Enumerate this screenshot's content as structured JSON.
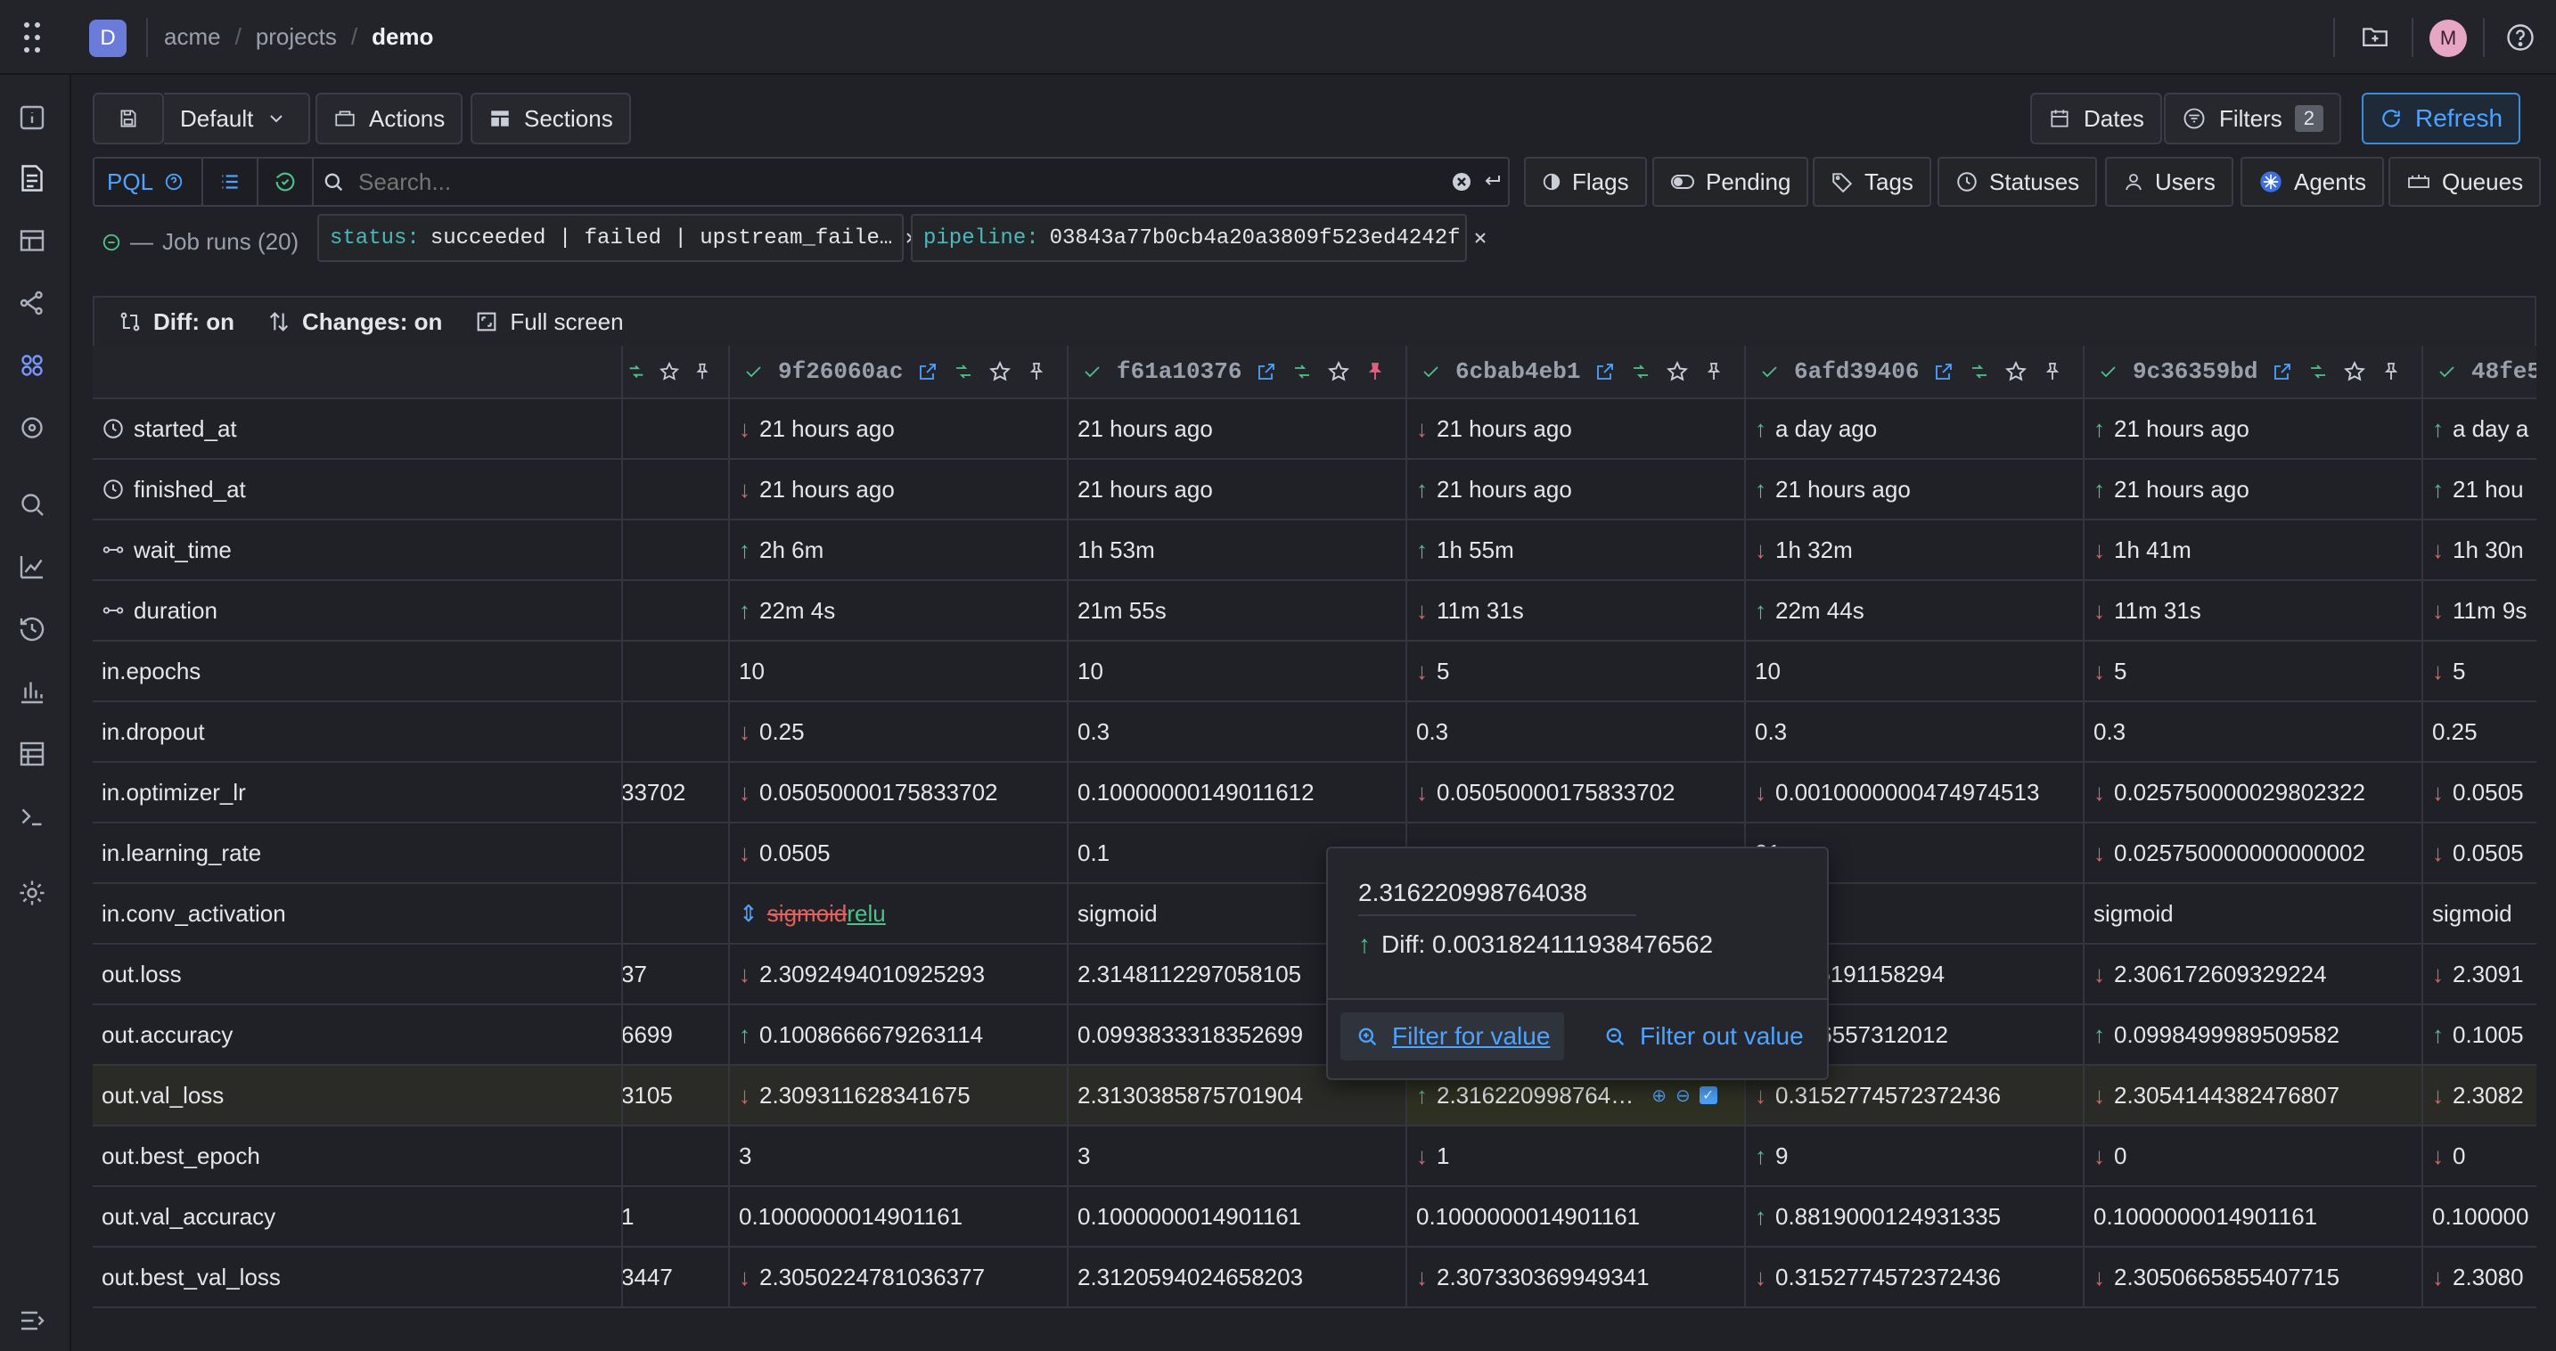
{
  "header": {
    "workspace_letter": "D",
    "breadcrumb": [
      "acme",
      "projects",
      "demo"
    ],
    "avatar": "M"
  },
  "toolbar": {
    "preset": "Default",
    "actions": "Actions",
    "sections": "Sections",
    "dates": "Dates",
    "filters": "Filters",
    "filters_count": "2",
    "refresh": "Refresh"
  },
  "query": {
    "mode": "PQL",
    "search_placeholder": "Search...",
    "chips": [
      "Flags",
      "Pending",
      "Tags",
      "Statuses",
      "Users",
      "Agents",
      "Queues"
    ]
  },
  "filters_bar": {
    "title": "Job runs (20)",
    "status_key": "status:",
    "status_value": "succeeded | failed | upstream_faile…",
    "pipeline_key": "pipeline:",
    "pipeline_value": "03843a77b0cb4a20a3809f523ed4242f"
  },
  "grid_toolbar": {
    "diff": "Diff: on",
    "changes": "Changes: on",
    "fullscreen": "Full screen"
  },
  "columns": [
    {
      "hash": "9f26060ac",
      "pinned": false
    },
    {
      "hash": "f61a10376",
      "pinned": true
    },
    {
      "hash": "6cbab4eb1",
      "pinned": false
    },
    {
      "hash": "6afd39406",
      "pinned": false
    },
    {
      "hash": "9c36359bd",
      "pinned": false
    },
    {
      "hash": "48fe5",
      "pinned": false
    }
  ],
  "rows": [
    {
      "name": "started_at",
      "icon": "clock-icon",
      "partial": "",
      "cells": [
        {
          "v": "21 hours ago",
          "d": "down"
        },
        {
          "v": "21 hours ago",
          "d": ""
        },
        {
          "v": "21 hours ago",
          "d": "down"
        },
        {
          "v": "a day ago",
          "d": "up"
        },
        {
          "v": "21 hours ago",
          "d": "up"
        },
        {
          "v": "a day a",
          "d": "up"
        }
      ]
    },
    {
      "name": "finished_at",
      "icon": "clock-icon",
      "partial": "",
      "cells": [
        {
          "v": "21 hours ago",
          "d": "down"
        },
        {
          "v": "21 hours ago",
          "d": ""
        },
        {
          "v": "21 hours ago",
          "d": "up"
        },
        {
          "v": "21 hours ago",
          "d": "up"
        },
        {
          "v": "21 hours ago",
          "d": "up"
        },
        {
          "v": "21 hou",
          "d": "up"
        }
      ]
    },
    {
      "name": "wait_time",
      "icon": "duration-icon",
      "partial": "",
      "cells": [
        {
          "v": "2h 6m",
          "d": "up"
        },
        {
          "v": "1h 53m",
          "d": ""
        },
        {
          "v": "1h 55m",
          "d": "up"
        },
        {
          "v": "1h 32m",
          "d": "down"
        },
        {
          "v": "1h 41m",
          "d": "down"
        },
        {
          "v": "1h 30n",
          "d": "down"
        }
      ]
    },
    {
      "name": "duration",
      "icon": "duration-icon",
      "partial": "",
      "cells": [
        {
          "v": "22m 4s",
          "d": "up"
        },
        {
          "v": "21m 55s",
          "d": ""
        },
        {
          "v": "11m 31s",
          "d": "down"
        },
        {
          "v": "22m 44s",
          "d": "up"
        },
        {
          "v": "11m 31s",
          "d": "down"
        },
        {
          "v": "11m 9s",
          "d": "down"
        }
      ]
    },
    {
      "name": "in.epochs",
      "icon": "",
      "partial": "",
      "cells": [
        {
          "v": "10",
          "d": ""
        },
        {
          "v": "10",
          "d": ""
        },
        {
          "v": "5",
          "d": "down"
        },
        {
          "v": "10",
          "d": ""
        },
        {
          "v": "5",
          "d": "down"
        },
        {
          "v": "5",
          "d": "down"
        }
      ]
    },
    {
      "name": "in.dropout",
      "icon": "",
      "partial": "",
      "cells": [
        {
          "v": "0.25",
          "d": "down"
        },
        {
          "v": "0.3",
          "d": ""
        },
        {
          "v": "0.3",
          "d": ""
        },
        {
          "v": "0.3",
          "d": ""
        },
        {
          "v": "0.3",
          "d": ""
        },
        {
          "v": "0.25",
          "d": ""
        }
      ]
    },
    {
      "name": "in.optimizer_lr",
      "icon": "",
      "partial": "33702",
      "cells": [
        {
          "v": "0.05050000175833702",
          "d": "down"
        },
        {
          "v": "0.10000000149011612",
          "d": ""
        },
        {
          "v": "0.05050000175833702",
          "d": "down"
        },
        {
          "v": "0.0010000000474974513",
          "d": "down"
        },
        {
          "v": "0.025750000029802322",
          "d": "down"
        },
        {
          "v": "0.0505",
          "d": "down"
        }
      ]
    },
    {
      "name": "in.learning_rate",
      "icon": "",
      "partial": "",
      "cells": [
        {
          "v": "0.0505",
          "d": "down"
        },
        {
          "v": "0.1",
          "d": ""
        },
        {
          "v": "",
          "d": ""
        },
        {
          "v": "01",
          "d": ""
        },
        {
          "v": "0.025750000000000002",
          "d": "down"
        },
        {
          "v": "0.0505",
          "d": "down"
        }
      ]
    },
    {
      "name": "in.conv_activation",
      "icon": "",
      "partial": "",
      "cells": [
        {
          "v": "",
          "d": "change",
          "old": "sigmoid",
          "new": "relu"
        },
        {
          "v": "sigmoid",
          "d": ""
        },
        {
          "v": "",
          "d": ""
        },
        {
          "v": "d",
          "d": ""
        },
        {
          "v": "sigmoid",
          "d": ""
        },
        {
          "v": "sigmoid",
          "d": ""
        }
      ]
    },
    {
      "name": "out.loss",
      "icon": "",
      "partial": "37",
      "cells": [
        {
          "v": "2.3092494010925293",
          "d": "down"
        },
        {
          "v": "2.3148112297058105",
          "d": ""
        },
        {
          "v": "",
          "d": ""
        },
        {
          "v": "113106191158294",
          "d": ""
        },
        {
          "v": "2.306172609329224",
          "d": "down"
        },
        {
          "v": "2.3091",
          "d": "down"
        }
      ]
    },
    {
      "name": "out.accuracy",
      "icon": "",
      "partial": "6699",
      "cells": [
        {
          "v": "0.1008666679263114",
          "d": "up"
        },
        {
          "v": "0.0993833318352699",
          "d": ""
        },
        {
          "v": "",
          "d": ""
        },
        {
          "v": "327166557312012",
          "d": ""
        },
        {
          "v": "0.0998499989509582",
          "d": "up"
        },
        {
          "v": "0.1005",
          "d": "up"
        }
      ]
    },
    {
      "name": "out.val_loss",
      "icon": "",
      "partial": "3105",
      "cells": [
        {
          "v": "2.309311628341675",
          "d": "down"
        },
        {
          "v": "2.3130385875701904",
          "d": ""
        },
        {
          "v": "2.316220998764…",
          "d": "up"
        },
        {
          "v": "0.3152774572372436",
          "d": "down"
        },
        {
          "v": "2.3054144382476807",
          "d": "down"
        },
        {
          "v": "2.3082",
          "d": "down"
        }
      ]
    },
    {
      "name": "out.best_epoch",
      "icon": "",
      "partial": "",
      "cells": [
        {
          "v": "3",
          "d": ""
        },
        {
          "v": "3",
          "d": ""
        },
        {
          "v": "1",
          "d": "down"
        },
        {
          "v": "9",
          "d": "up"
        },
        {
          "v": "0",
          "d": "down"
        },
        {
          "v": "0",
          "d": "down"
        }
      ]
    },
    {
      "name": "out.val_accuracy",
      "icon": "",
      "partial": "1",
      "cells": [
        {
          "v": "0.1000000014901161",
          "d": ""
        },
        {
          "v": "0.1000000014901161",
          "d": ""
        },
        {
          "v": "0.1000000014901161",
          "d": ""
        },
        {
          "v": "0.8819000124931335",
          "d": "up"
        },
        {
          "v": "0.1000000014901161",
          "d": ""
        },
        {
          "v": "0.100000",
          "d": ""
        }
      ]
    },
    {
      "name": "out.best_val_loss",
      "icon": "",
      "partial": "3447",
      "cells": [
        {
          "v": "2.3050224781036377",
          "d": "down"
        },
        {
          "v": "2.3120594024658203",
          "d": ""
        },
        {
          "v": "2.307330369949341",
          "d": "down"
        },
        {
          "v": "0.3152774572372436",
          "d": "down"
        },
        {
          "v": "2.3050665855407715",
          "d": "down"
        },
        {
          "v": "2.3080",
          "d": "down"
        }
      ]
    }
  ],
  "popup": {
    "value": "2.316220998764038",
    "diff": "Diff: 0.0031824111938476562",
    "filter_for": "Filter for value",
    "filter_out": "Filter out value"
  },
  "colors": {
    "accent": "#4da3ff",
    "up": "#4cc38a",
    "down": "#e3605c",
    "bg": "#1f2127"
  }
}
